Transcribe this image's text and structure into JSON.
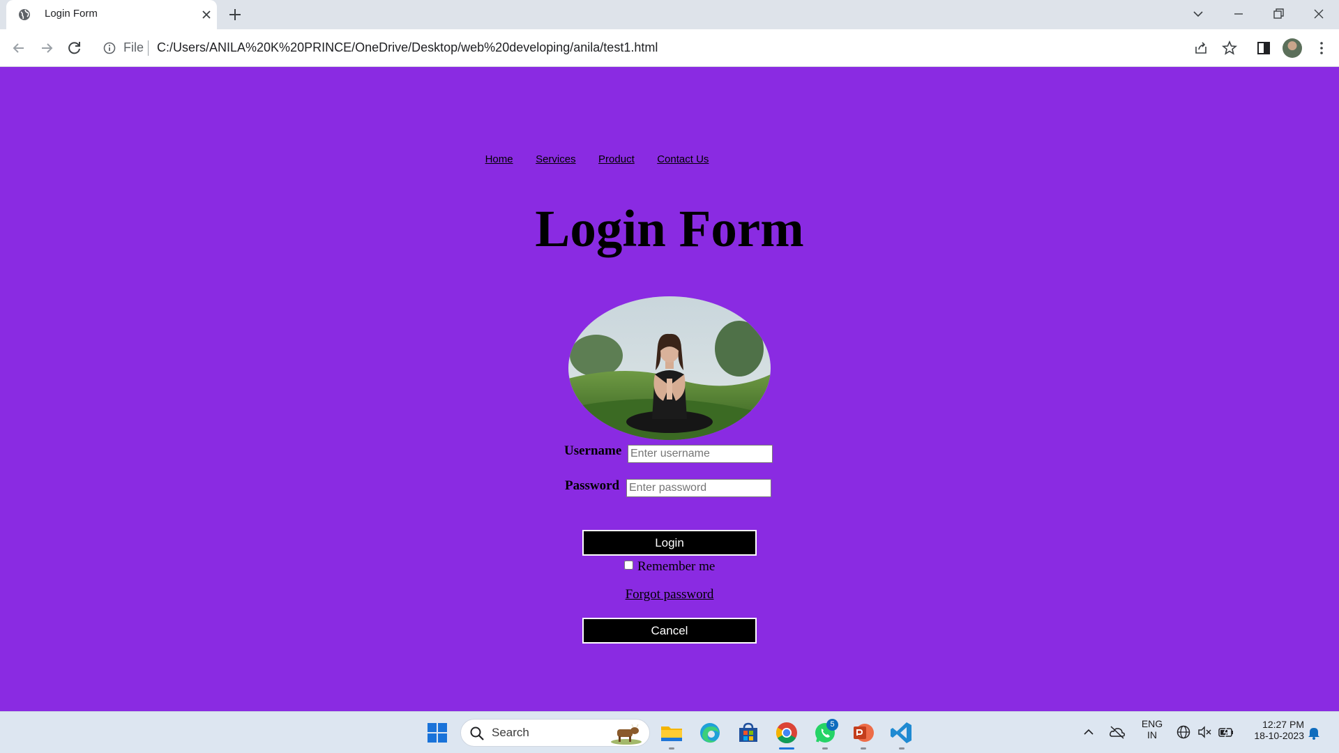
{
  "browser": {
    "tab_title": "Login Form",
    "address_prefix": "File",
    "url": "C:/Users/ANILA%20K%20PRINCE/OneDrive/Desktop/web%20developing/anila/test1.html"
  },
  "nav": {
    "links": [
      "Home",
      "Services",
      "Product",
      "Contact Us"
    ]
  },
  "page": {
    "title": "Login Form",
    "username_label": "Username",
    "username_placeholder": "Enter username",
    "password_label": "Password",
    "password_placeholder": "Enter password",
    "login_button": "Login",
    "remember_label": "Remember me",
    "forgot_link": "Forgot password",
    "cancel_button": "Cancel",
    "background_color": "#8a2be2"
  },
  "taskbar": {
    "search_placeholder": "Search",
    "whatsapp_badge": "5",
    "language_line1": "ENG",
    "language_line2": "IN",
    "time": "12:27 PM",
    "date": "18-10-2023"
  }
}
